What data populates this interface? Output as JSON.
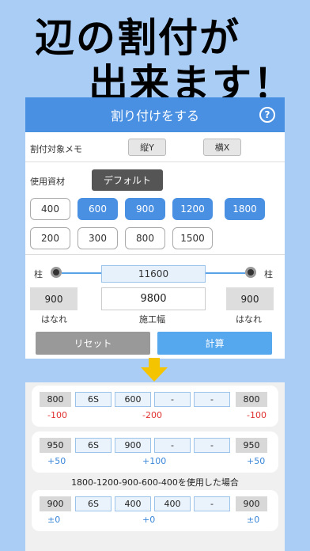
{
  "headline": {
    "line1": "辺の割付が",
    "line2": "出来ます！"
  },
  "panel": {
    "title": "割り付けをする",
    "help_icon": "?",
    "memo_label": "割付対象メモ",
    "vertical_label": "縦Y",
    "horizontal_label": "横X",
    "material_label": "使用資材",
    "default_label": "デフォルト",
    "sizes_row1": [
      {
        "label": "400",
        "selected": false
      },
      {
        "label": "600",
        "selected": true
      },
      {
        "label": "900",
        "selected": true
      },
      {
        "label": "1200",
        "selected": true
      },
      {
        "label": "1800",
        "selected": true
      }
    ],
    "sizes_row2": [
      {
        "label": "200",
        "selected": false
      },
      {
        "label": "300",
        "selected": false
      },
      {
        "label": "800",
        "selected": false
      },
      {
        "label": "1500",
        "selected": false
      }
    ],
    "pillar_left": "柱",
    "pillar_right": "柱",
    "total": "11600",
    "gap_left": "900",
    "gap_right": "900",
    "work_width": "9800",
    "gap_left_label": "はなれ",
    "gap_right_label": "はなれ",
    "work_width_label": "施工幅",
    "reset_label": "リセット",
    "calc_label": "計算"
  },
  "results": [
    {
      "cells": [
        "800",
        "6S",
        "600",
        "-",
        "-",
        "800"
      ],
      "diffs": [
        "-100",
        "-200",
        "-100"
      ],
      "diff_color": "#e03030"
    },
    {
      "cells": [
        "950",
        "6S",
        "900",
        "-",
        "-",
        "950"
      ],
      "diffs": [
        "+50",
        "+100",
        "+50"
      ],
      "diff_color": "#3a86d8"
    },
    {
      "caption": "1800-1200-900-600-400を使用した場合",
      "cells": [
        "900",
        "6S",
        "400",
        "400",
        "-",
        "900"
      ],
      "diffs": [
        "±0",
        "+0",
        "±0"
      ],
      "diff_color": "#3a86d8"
    }
  ],
  "colors": {
    "accent": "#4a90e2",
    "background": "#a9cdf5",
    "arrow": "#f5c400"
  }
}
